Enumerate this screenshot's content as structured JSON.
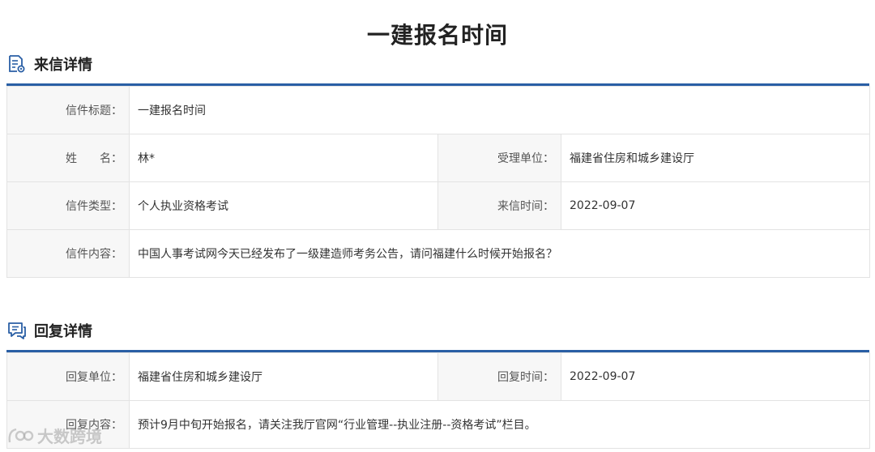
{
  "page": {
    "title": "一建报名时间"
  },
  "letter_section": {
    "heading": "来信详情",
    "title_label": "信件标题：",
    "title_value": "一建报名时间",
    "name_label": "姓　　名：",
    "name_value": "林*",
    "dept_label": "受理单位：",
    "dept_value": "福建省住房和城乡建设厅",
    "type_label": "信件类型：",
    "type_value": "个人执业资格考试",
    "time_label": "来信时间：",
    "time_value": "2022-09-07",
    "content_label": "信件内容：",
    "content_value": "中国人事考试网今天已经发布了一级建造师考务公告，请问福建什么时候开始报名？"
  },
  "reply_section": {
    "heading": "回复详情",
    "unit_label": "回复单位：",
    "unit_value": "福建省住房和城乡建设厅",
    "time_label": "回复时间：",
    "time_value": "2022-09-07",
    "content_label": "回复内容：",
    "content_value": "预计9月中旬开始报名，请关注我厅官网“行业管理--执业注册--资格考试”栏目。"
  },
  "watermark": {
    "text": "大数跨境"
  },
  "colors": {
    "accent": "#2a5fa5",
    "label_bg": "#f7f7f7",
    "border": "#e3e3e3"
  }
}
